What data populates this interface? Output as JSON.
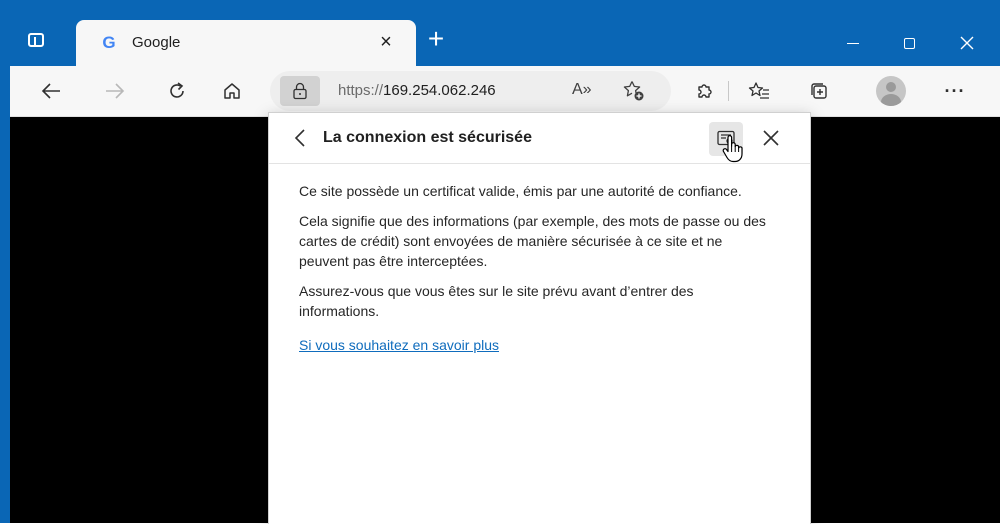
{
  "tab": {
    "favicon": "G",
    "title": "Google",
    "close": "×"
  },
  "new_tab": "+",
  "address": {
    "scheme": "https://",
    "host": "169.254.062.246",
    "read_aloud": "A»"
  },
  "popup": {
    "title": "La connexion est sécurisée",
    "paragraphs": [
      "Ce site possède un certificat valide, émis par une autorité de confiance.",
      "Cela signifie que des informations (par exemple, des mots de passe ou des cartes de crédit) sont envoyées de manière sécurisée à ce site et ne peuvent pas être interceptées.",
      "Assurez-vous que vous êtes sur le site prévu avant d’entrer des informations."
    ],
    "learn_more": "Si vous souhaitez en savoir plus"
  },
  "toolbar": {
    "more": "···"
  },
  "colors": {
    "frame": "#0a66b5",
    "toolbar": "#f7f7f7",
    "link": "#0f6cbd",
    "page": "#000000"
  },
  "icons": {
    "tab_actions": "tab-actions-icon",
    "back": "arrow-left-icon",
    "forward": "arrow-right-icon",
    "refresh": "refresh-icon",
    "home": "home-icon",
    "lock": "lock-icon",
    "favorites_add": "star-plus-icon",
    "extensions": "puzzle-icon",
    "favorites": "favorites-list-icon",
    "collections": "collections-icon",
    "certificate": "certificate-icon",
    "close": "close-icon"
  }
}
